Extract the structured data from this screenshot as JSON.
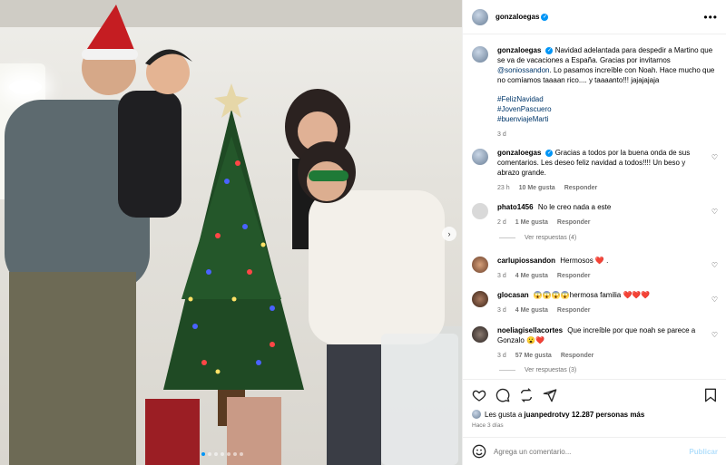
{
  "post": {
    "username": "gonzaloegas",
    "caption_pre": "Navidad adelantada para despedir a Martino que se va de vacaciones a España. Gracias por invitarnos ",
    "caption_mention": "@soniossandon",
    "caption_post": ". Lo pasamos increíble con Noah. Hace mucho que no comíamos taaaan rico.... y taaaanto!!! jajajajaja",
    "hashtags": [
      "#FelizNavidad",
      "#JovenPascuero",
      "#buenviajeMarti"
    ],
    "time": "3 d"
  },
  "comments": [
    {
      "user": "gonzaloegas",
      "verified": true,
      "text": "Gracias a todos por la buena onda de sus comentarios. Les deseo feliz navidad a todos!!!! Un beso y abrazo grande.",
      "time": "23 h",
      "likes": "10 Me gusta",
      "reply": "Responder"
    },
    {
      "user": "phato1456",
      "text": "No le creo nada a este",
      "time": "2 d",
      "likes": "1 Me gusta",
      "reply": "Responder",
      "view_replies": "Ver respuestas (4)"
    },
    {
      "user": "carlupiossandon",
      "text": "Hermosos ❤️ .",
      "time": "3 d",
      "likes": "4 Me gusta",
      "reply": "Responder"
    },
    {
      "user": "glocasan",
      "text": "😱😱😱😱hermosa familia ❤️❤️❤️",
      "time": "3 d",
      "likes": "4 Me gusta",
      "reply": "Responder"
    },
    {
      "user": "noeliagisellacortes",
      "text": "Que increíble por que noah se parece a Gonzalo 😮❤️",
      "time": "3 d",
      "likes": "57 Me gusta",
      "reply": "Responder",
      "view_replies": "Ver respuestas (3)"
    }
  ],
  "likes_line": {
    "pre": "Les gusta a ",
    "user": "juanpedrotv",
    "post": " y 12.287 personas más"
  },
  "ago": "Hace 3 días",
  "composer": {
    "placeholder": "Agrega un comentario...",
    "publish": "Publicar"
  },
  "carousel": {
    "count": 7,
    "active": 1
  }
}
